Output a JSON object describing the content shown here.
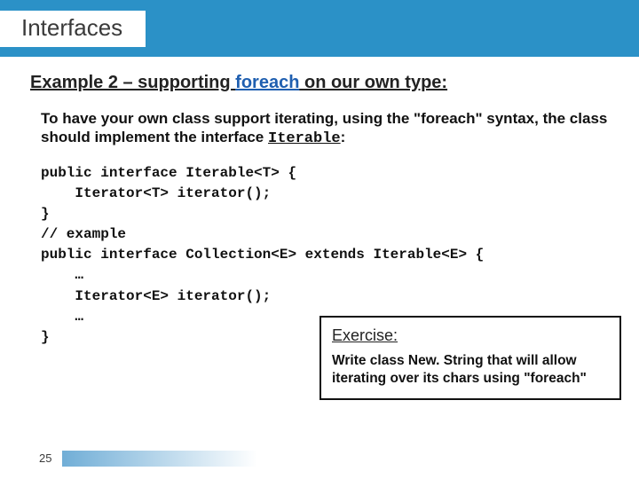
{
  "header": {
    "title": "Interfaces"
  },
  "subheading": {
    "prefix": "Example 2 – supporting ",
    "foreach": "foreach",
    "suffix": " on our own type:"
  },
  "body": {
    "text_part1": "To have your own class support iterating, using the \"foreach\" syntax, the class should implement the interface ",
    "iterable_word": "Iterable",
    "colon": ":"
  },
  "code": {
    "line1": "public interface Iterable<T> {",
    "line2": "    Iterator<T> iterator();",
    "line3": "}",
    "line4": "// example",
    "line5": "public interface Collection<E> extends Iterable<E> {",
    "line6": "    …",
    "line7": "    Iterator<E> iterator();",
    "line8": "    …",
    "line9": "}"
  },
  "exercise": {
    "title": "Exercise:",
    "body": "Write class New. String that will allow iterating over its chars using \"foreach\""
  },
  "page_number": "25"
}
